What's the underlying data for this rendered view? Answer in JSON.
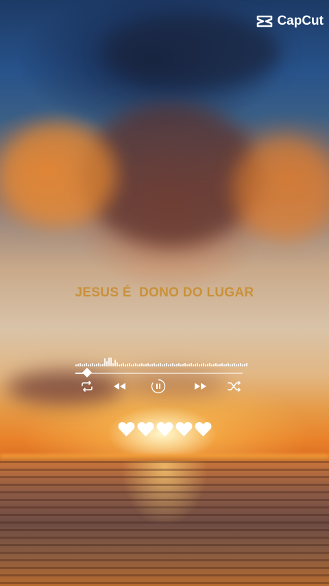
{
  "brand": {
    "name": "CapCut",
    "icon": "capcut-logo-icon"
  },
  "song": {
    "title": "JESUS É  DONO DO LUGAR"
  },
  "player": {
    "progress": 0.07,
    "controls": [
      "repeat-icon",
      "rewind-icon",
      "pause-icon",
      "fast-forward-icon",
      "shuffle-icon"
    ]
  },
  "rating": {
    "hearts": 5,
    "icon": "heart-icon"
  },
  "colors": {
    "title": "#c9913a",
    "controls": "#ffffff",
    "hearts": "#ffffff"
  }
}
